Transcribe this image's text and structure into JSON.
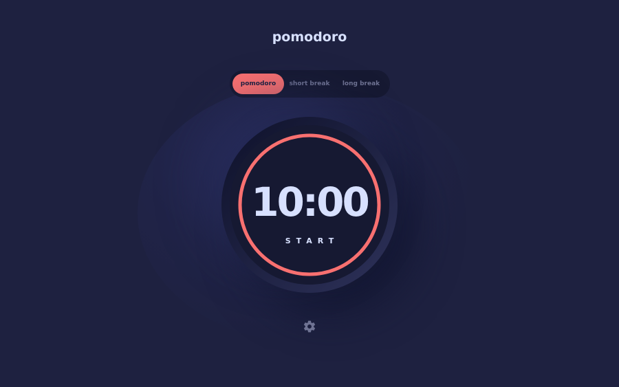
{
  "app": {
    "title": "pomodoro"
  },
  "tabs": [
    {
      "label": "pomodoro",
      "active": true
    },
    {
      "label": "short break",
      "active": false
    },
    {
      "label": "long break",
      "active": false
    }
  ],
  "timer": {
    "time": "10:00",
    "action_label": "START",
    "progress": 1.0
  },
  "settings": {
    "icon": "gear-icon"
  },
  "colors": {
    "background": "#1e2140",
    "accent": "#f87070",
    "text": "#d7e0ff",
    "muted": "#6f7393",
    "dark": "#161932"
  }
}
